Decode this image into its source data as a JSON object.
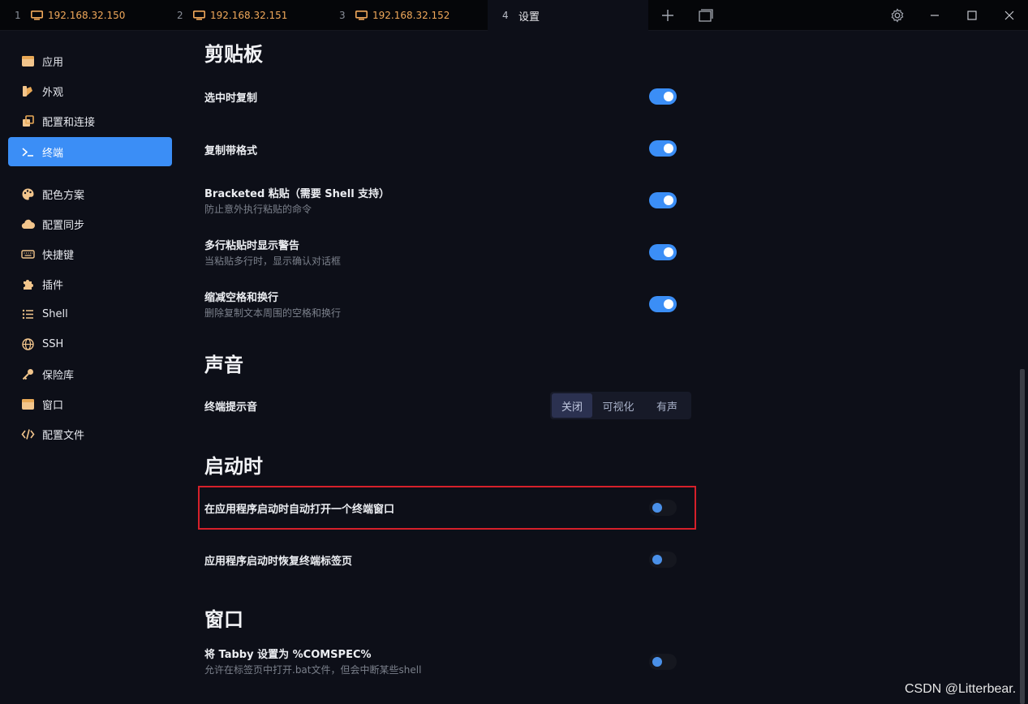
{
  "tabs": [
    {
      "num": "1",
      "label": "192.168.32.150",
      "icon": "monitor-icon"
    },
    {
      "num": "2",
      "label": "192.168.32.151",
      "icon": "monitor-icon"
    },
    {
      "num": "3",
      "label": "192.168.32.152",
      "icon": "monitor-icon"
    },
    {
      "num": "4",
      "label": "设置",
      "active": true
    }
  ],
  "titlebar": {
    "new_tab_icon": "plus-icon",
    "window_icon": "window-stack-icon",
    "settings_icon": "gear-icon",
    "minimize_icon": "minimize-icon",
    "maximize_icon": "maximize-icon",
    "close_icon": "close-icon"
  },
  "sidebar": {
    "items": [
      {
        "label": "应用",
        "icon": "window-icon"
      },
      {
        "label": "外观",
        "icon": "palette-swatch-icon"
      },
      {
        "label": "配置和连接",
        "icon": "profiles-icon"
      },
      {
        "label": "终端",
        "icon": "terminal-icon",
        "active": true
      },
      {
        "label": "配色方案",
        "icon": "palette-icon"
      },
      {
        "label": "配置同步",
        "icon": "cloud-icon"
      },
      {
        "label": "快捷键",
        "icon": "keyboard-icon"
      },
      {
        "label": "插件",
        "icon": "puzzle-icon"
      },
      {
        "label": "Shell",
        "icon": "list-icon"
      },
      {
        "label": "SSH",
        "icon": "globe-icon"
      },
      {
        "label": "保险库",
        "icon": "key-icon"
      },
      {
        "label": "窗口",
        "icon": "window-icon"
      },
      {
        "label": "配置文件",
        "icon": "code-icon"
      }
    ]
  },
  "content": {
    "clipboard": {
      "title": "剪贴板",
      "copy_on_select": {
        "title": "选中时复制",
        "enabled": true
      },
      "copy_formatted": {
        "title": "复制带格式",
        "enabled": true
      },
      "bracketed": {
        "title": "Bracketed 粘贴（需要 Shell 支持）",
        "subtitle": "防止意外执行粘贴的命令",
        "enabled": true
      },
      "multiline_warn": {
        "title": "多行粘贴时显示警告",
        "subtitle": "当粘贴多行时，显示确认对话框",
        "enabled": true
      },
      "trim": {
        "title": "缩减空格和换行",
        "subtitle": "删除复制文本周围的空格和换行",
        "enabled": true
      }
    },
    "sound": {
      "title": "声音",
      "bell": {
        "title": "终端提示音",
        "options": [
          "关闭",
          "可视化",
          "有声"
        ],
        "selected": "关闭"
      }
    },
    "startup": {
      "title": "启动时",
      "auto_open": {
        "title": "在应用程序启动时自动打开一个终端窗口",
        "enabled": false
      },
      "restore_tabs": {
        "title": "应用程序启动时恢复终端标签页",
        "enabled": false
      }
    },
    "window": {
      "title": "窗口",
      "comspec": {
        "title": "将 Tabby 设置为 %COMSPEC%",
        "subtitle": "允许在标签页中打开.bat文件，但会中断某些shell",
        "enabled": false
      }
    }
  },
  "watermark": "CSDN @Litterbear.",
  "colors": {
    "accent": "#3b8ef6",
    "tab_label": "#f0a85a",
    "highlight": "#d6202a",
    "background": "#0d0f18"
  }
}
